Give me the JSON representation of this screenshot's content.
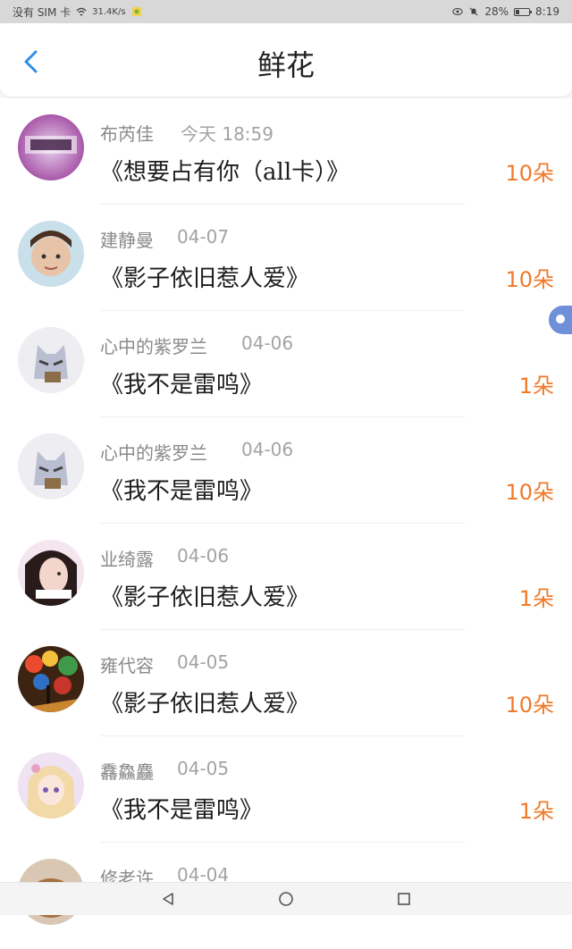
{
  "status_bar": {
    "carrier": "没有 SIM 卡",
    "speed": "31.4K/s",
    "battery_percent": "28%",
    "time": "8:19"
  },
  "header": {
    "title": "鲜花"
  },
  "colors": {
    "accent_blue": "#2f8fe8",
    "count_orange": "#f07a2a"
  },
  "items": [
    {
      "name": "布芮佳",
      "date": "今天 18:59",
      "gift": "《想要占有你（all卡）》",
      "count": "10朵",
      "avatar": "avatar-tianxie"
    },
    {
      "name": "建静曼",
      "date": "04-07",
      "gift": "《影子依旧惹人爱》",
      "count": "10朵",
      "avatar": "avatar-boy"
    },
    {
      "name": "心中的紫罗兰",
      "date": "04-06",
      "gift": "《我不是雷鸣》",
      "count": "1朵",
      "avatar": "avatar-mask"
    },
    {
      "name": "心中的紫罗兰",
      "date": "04-06",
      "gift": "《我不是雷鸣》",
      "count": "10朵",
      "avatar": "avatar-mask"
    },
    {
      "name": "业绮露",
      "date": "04-06",
      "gift": "《影子依旧惹人爱》",
      "count": "1朵",
      "avatar": "avatar-girl"
    },
    {
      "name": "雍代容",
      "date": "04-05",
      "gift": "《影子依旧惹人爱》",
      "count": "10朵",
      "avatar": "avatar-painting"
    },
    {
      "name": "馫鱻麤",
      "date": "04-05",
      "gift": "《我不是雷鸣》",
      "count": "1朵",
      "avatar": "avatar-anime"
    },
    {
      "name": "修老许",
      "date": "04-04",
      "gift": "",
      "count": "",
      "avatar": "avatar-hamster"
    }
  ]
}
